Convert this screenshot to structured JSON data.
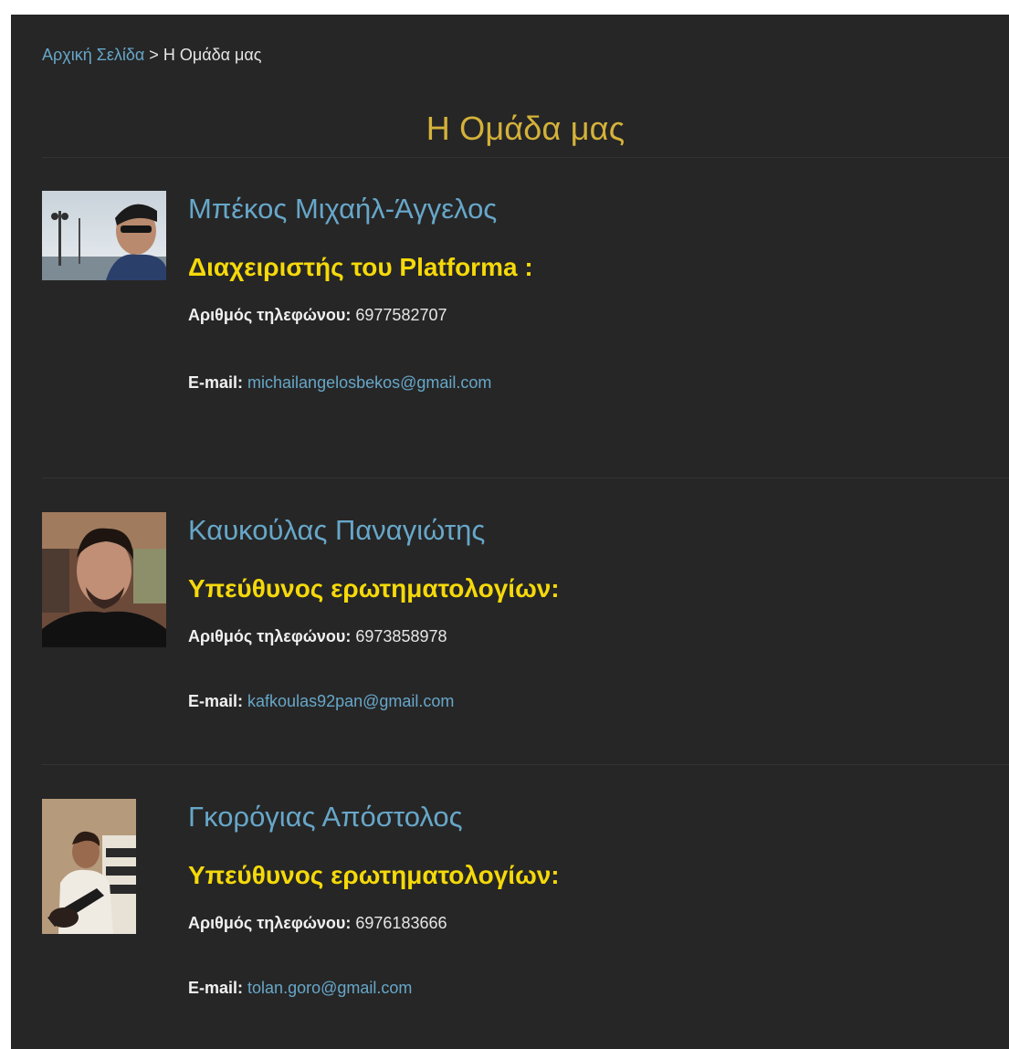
{
  "breadcrumb": {
    "home": "Αρχική Σελίδα",
    "separator": ">",
    "current": "Η Ομάδα μας"
  },
  "page_title": "Η Ομάδα μας",
  "members": [
    {
      "name": "Μπέκος Μιχαήλ-Άγγελος",
      "role": "Διαχειριστής του Platforma :",
      "phone_label": "Αριθμός τηλεφώνου:",
      "phone": "6977582707",
      "email_label": "E-mail:",
      "email": "michailangelosbekos@gmail.com"
    },
    {
      "name": "Καυκούλας Παναγιώτης",
      "role": "Υπεύθυνος ερωτηματολογίων:",
      "phone_label": "Αριθμός τηλεφώνου:",
      "phone": "6973858978",
      "email_label": "E-mail:",
      "email": "kafkoulas92pan@gmail.com"
    },
    {
      "name": "Γκορόγιας Απόστολος",
      "role": "Υπεύθυνος ερωτηματολογίων:",
      "phone_label": "Αριθμός τηλεφώνου:",
      "phone": "6976183666",
      "email_label": "E-mail:",
      "email": "tolan.goro@gmail.com"
    }
  ],
  "colors": {
    "background": "#262626",
    "link": "#67a7c9",
    "title": "#d4b23a",
    "role": "#f5d90a",
    "text": "#e6e6e6"
  }
}
